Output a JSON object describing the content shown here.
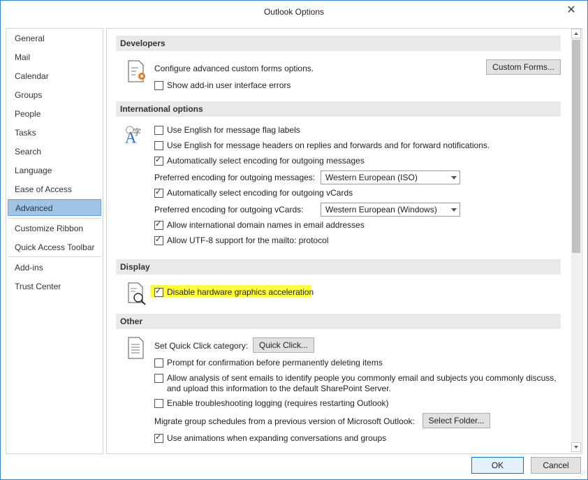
{
  "window": {
    "title": "Outlook Options",
    "close_glyph": "✕"
  },
  "sidebar": {
    "items": [
      {
        "label": "General"
      },
      {
        "label": "Mail"
      },
      {
        "label": "Calendar"
      },
      {
        "label": "Groups"
      },
      {
        "label": "People"
      },
      {
        "label": "Tasks"
      },
      {
        "label": "Search"
      },
      {
        "label": "Language"
      },
      {
        "label": "Ease of Access"
      },
      {
        "label": "Advanced",
        "selected": true
      },
      {
        "label": "Customize Ribbon"
      },
      {
        "label": "Quick Access Toolbar"
      },
      {
        "label": "Add-ins"
      },
      {
        "label": "Trust Center"
      }
    ]
  },
  "developers": {
    "header": "Developers",
    "configure_label": "Configure advanced custom forms options.",
    "custom_forms_button": "Custom Forms...",
    "show_addin_errors": {
      "label": "Show add-in user interface errors",
      "checked": false
    }
  },
  "international": {
    "header": "International options",
    "english_flag_labels": {
      "label": "Use English for message flag labels",
      "checked": false
    },
    "english_headers": {
      "label": "Use English for message headers on replies and forwards and for forward notifications.",
      "checked": false
    },
    "auto_encoding_messages": {
      "label": "Automatically select encoding for outgoing messages",
      "checked": true
    },
    "preferred_encoding_messages_label": "Preferred encoding for outgoing messages:",
    "preferred_encoding_messages_value": "Western European (ISO)",
    "auto_encoding_vcards": {
      "label": "Automatically select encoding for outgoing vCards",
      "checked": true
    },
    "preferred_encoding_vcards_label": "Preferred encoding for outgoing vCards:",
    "preferred_encoding_vcards_value": "Western European (Windows)",
    "allow_idn": {
      "label": "Allow international domain names in email addresses",
      "checked": true
    },
    "allow_utf8_mailto": {
      "label": "Allow UTF-8 support for the mailto: protocol",
      "checked": true
    }
  },
  "display": {
    "header": "Display",
    "disable_hw_accel": {
      "label": "Disable hardware graphics acceleration",
      "checked": true,
      "highlight_color": "#ffff3a"
    }
  },
  "other": {
    "header": "Other",
    "quick_click_label": "Set Quick Click category:",
    "quick_click_button": "Quick Click...",
    "prompt_delete": {
      "label": "Prompt for confirmation before permanently deleting items",
      "checked": false
    },
    "allow_analysis": {
      "label_line1": "Allow analysis of sent emails to identify people you commonly email and subjects you commonly discuss,",
      "label_line2": "and upload this information to the default SharePoint Server.",
      "checked": false
    },
    "troubleshooting_logging": {
      "label": "Enable troubleshooting logging (requires restarting Outlook)",
      "checked": false
    },
    "migrate_label": "Migrate group schedules from a previous version of Microsoft Outlook:",
    "select_folder_button": "Select Folder...",
    "use_animations": {
      "label": "Use animations when expanding conversations and groups",
      "checked": true
    }
  },
  "footer": {
    "ok_label": "OK",
    "cancel_label": "Cancel"
  },
  "colors": {
    "accent": "#0078d7",
    "selected_nav": "#9ec4e8",
    "section_header_bg": "#e9e9e9"
  }
}
